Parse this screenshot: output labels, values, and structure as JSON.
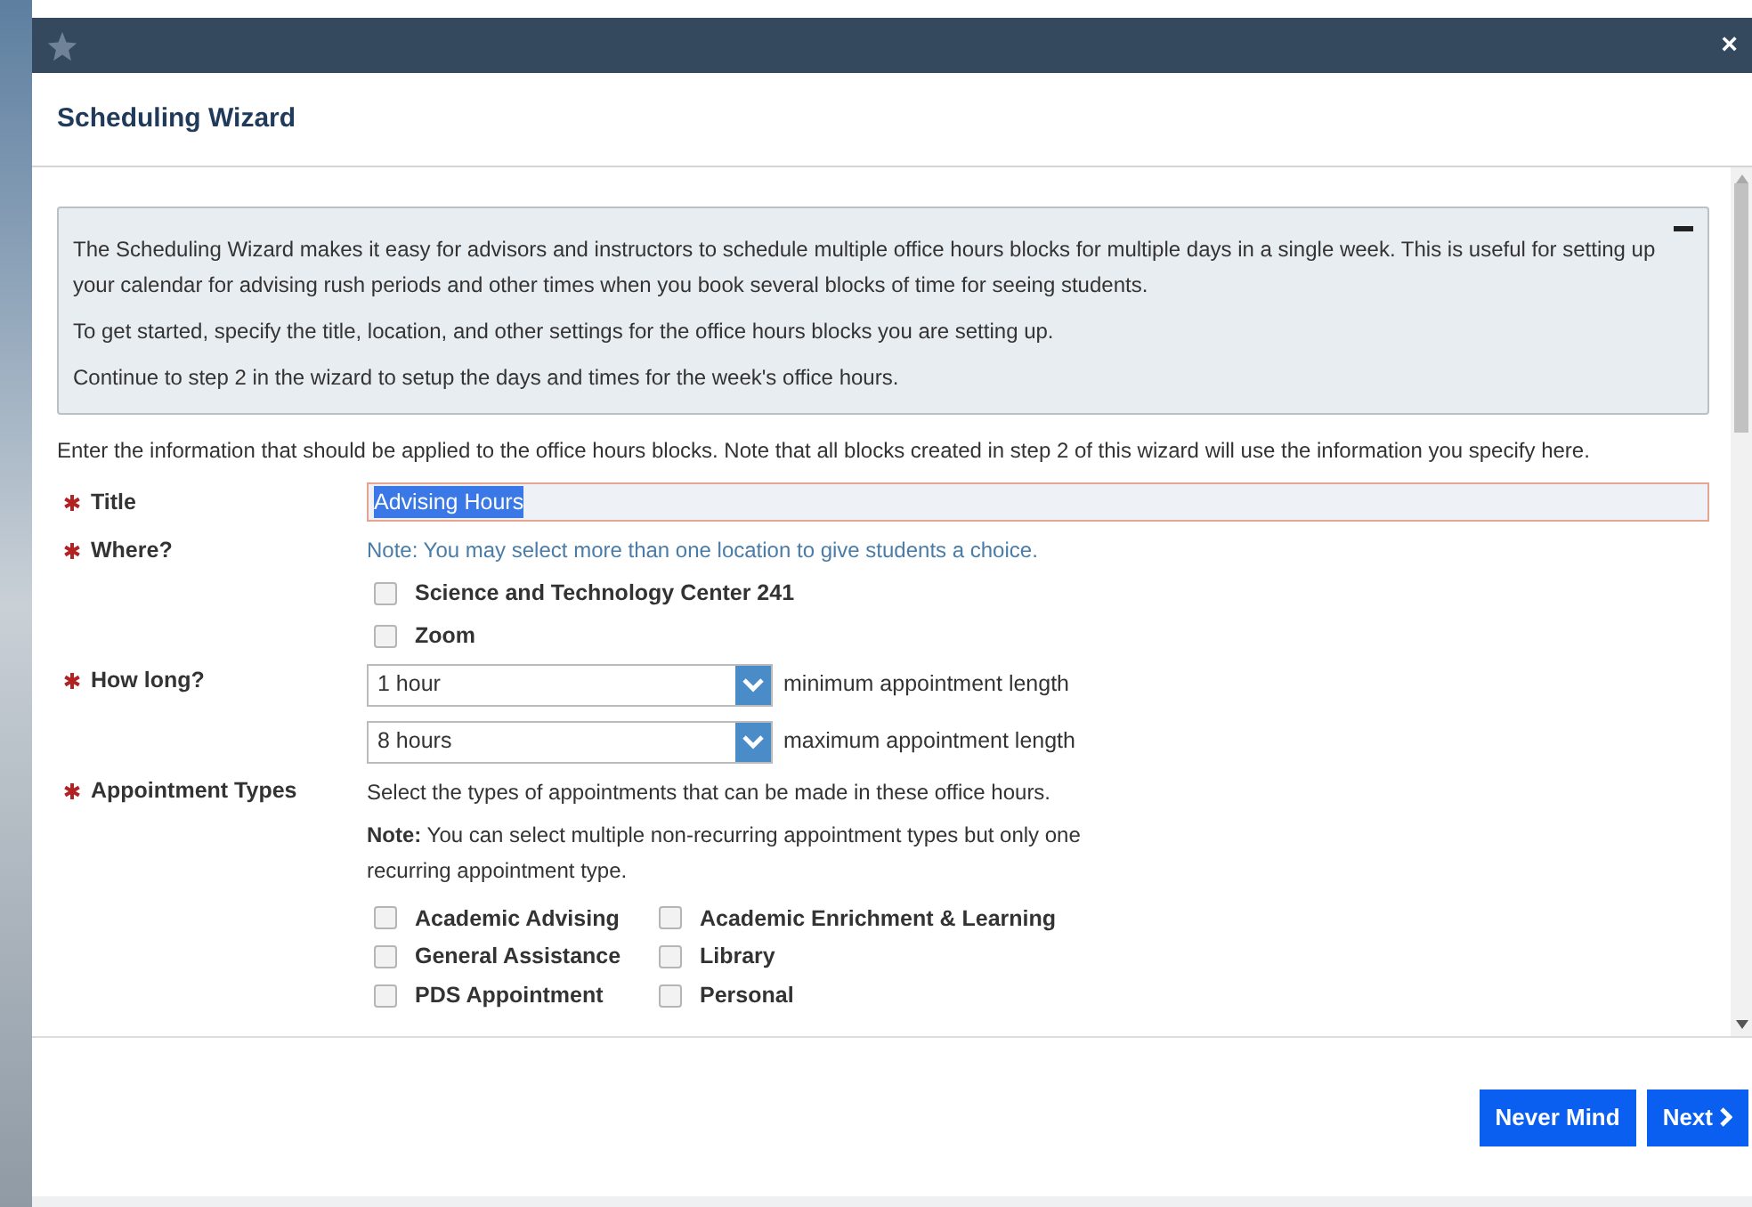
{
  "title_bar": {
    "close": "×"
  },
  "dialog": {
    "title": "Scheduling Wizard"
  },
  "info_panel": {
    "expanded": true,
    "paragraphs": [
      "The Scheduling Wizard makes it easy for advisors and instructors to schedule multiple office hours blocks for multiple days in a single week. This is useful for setting up your calendar for advising rush periods and other times when you book several blocks of time for seeing students.",
      "To get started, specify the title, location, and other settings for the office hours blocks you are setting up.",
      "Continue to step 2 in the wizard to setup the days and times for the week's office hours."
    ]
  },
  "intro": "Enter the information that should be applied to the office hours blocks. Note that all blocks created in step 2 of this wizard will use the information you specify here.",
  "form": [
    {
      "kind": "text",
      "label": "Title",
      "required": true,
      "value": "Advising Hours",
      "selected": true
    },
    {
      "kind": "checks",
      "label": "Where?",
      "required": true,
      "note": "Note: You may select more than one location to give students a choice.",
      "options": [
        {
          "label": "Science and Technology Center 241",
          "checked": false
        },
        {
          "label": "Zoom",
          "checked": false
        }
      ]
    },
    {
      "kind": "selects",
      "label": "How long?",
      "required": true,
      "selects": [
        {
          "value": "1 hour",
          "caption": "minimum appointment length"
        },
        {
          "value": "8 hours",
          "caption": "maximum appointment length"
        }
      ]
    },
    {
      "kind": "types",
      "label": "Appointment Types",
      "required": true,
      "description": "Select the types of appointments that can be made in these office hours.",
      "note": "**Note:** You can select multiple non-recurring appointment types but only one recurring appointment type.",
      "options": [
        {
          "label": "Academic Advising",
          "checked": false
        },
        {
          "label": "Academic Enrichment & Learning",
          "checked": false
        },
        {
          "label": "General Assistance",
          "checked": false
        },
        {
          "label": "Library",
          "checked": false
        },
        {
          "label": "PDS Appointment",
          "checked": false
        },
        {
          "label": "Personal",
          "checked": false
        }
      ]
    }
  ],
  "buttons": [
    {
      "label": "Never Mind",
      "kind": "plain"
    },
    {
      "label": "Next",
      "kind": "next"
    }
  ]
}
